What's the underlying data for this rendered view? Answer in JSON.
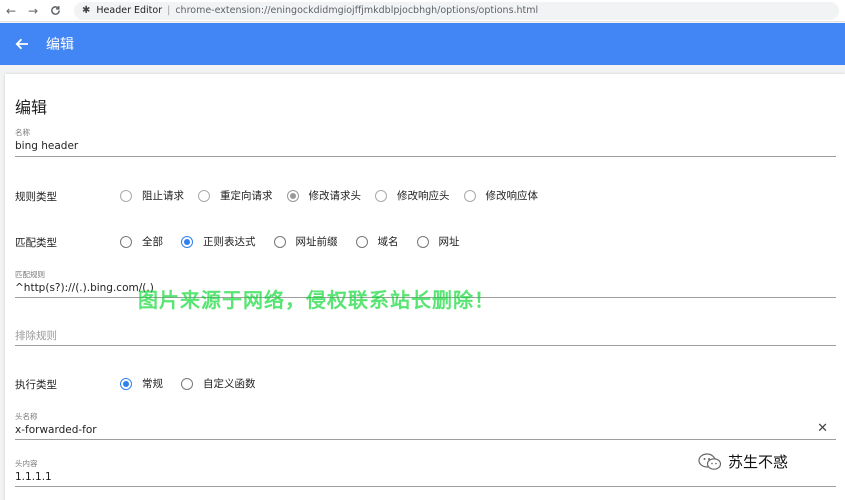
{
  "browser": {
    "app_name": "Header Editor",
    "url": "chrome-extension://eningockdidmgiojffjmkdblpjocbhgh/options/options.html"
  },
  "appbar": {
    "title": "编辑"
  },
  "card": {
    "title": "编辑"
  },
  "form": {
    "name": {
      "label": "名称",
      "value": "bing header"
    },
    "rule_type": {
      "label": "规则类型",
      "options": [
        "阻止请求",
        "重定向请求",
        "修改请求头",
        "修改响应头",
        "修改响应体"
      ],
      "selected": "修改请求头"
    },
    "match_type": {
      "label": "匹配类型",
      "options": [
        "全部",
        "正则表达式",
        "网址前缀",
        "域名",
        "网址"
      ],
      "selected": "正则表达式"
    },
    "match_rule": {
      "label": "匹配规则",
      "value": "^http(s?)://(.).bing.com/(.)"
    },
    "exclude_rule": {
      "placeholder": "排除规则"
    },
    "exec_type": {
      "label": "执行类型",
      "options": [
        "常规",
        "自定义函数"
      ],
      "selected": "常规"
    },
    "header_name": {
      "label": "头名称",
      "value": "x-forwarded-for"
    },
    "header_value": {
      "label": "头内容",
      "value": "1.1.1.1"
    }
  },
  "overlay": {
    "watermark": "图片来源于网络，侵权联系站长删除！",
    "account": "苏生不惑"
  },
  "colors": {
    "primary": "#4285f4",
    "radio_selected": "#2e7ff0",
    "watermark": "#00d728"
  }
}
